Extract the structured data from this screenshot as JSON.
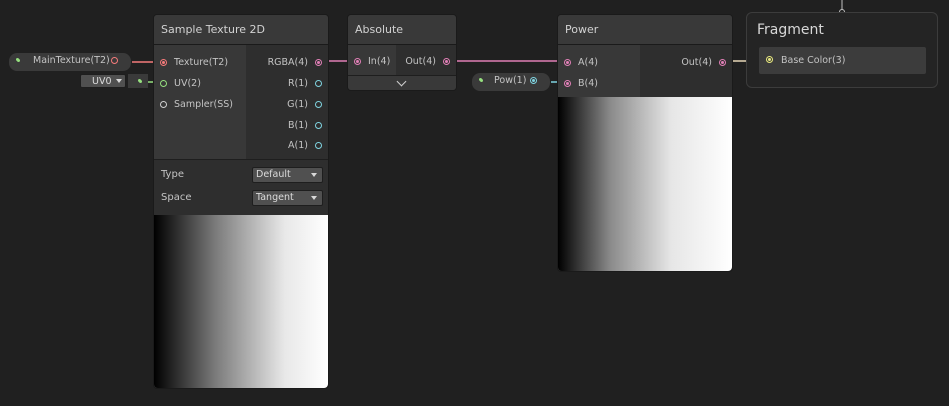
{
  "nodes": {
    "sample_texture": {
      "title": "Sample Texture 2D",
      "inputs": [
        "Texture(T2)",
        "UV(2)",
        "Sampler(SS)"
      ],
      "outputs": [
        "RGBA(4)",
        "R(1)",
        "G(1)",
        "B(1)",
        "A(1)"
      ],
      "type_label": "Type",
      "type_value": "Default",
      "space_label": "Space",
      "space_value": "Tangent"
    },
    "absolute": {
      "title": "Absolute",
      "input": "In(4)",
      "output": "Out(4)"
    },
    "power": {
      "title": "Power",
      "inputs": [
        "A(4)",
        "B(4)"
      ],
      "output": "Out(4)"
    },
    "fragment": {
      "title": "Fragment",
      "input": "Base Color(3)"
    }
  },
  "properties": {
    "main_texture": "MainTexture(T2)",
    "uv_dropdown": "UV0",
    "pow": "Pow(1)"
  },
  "colors": {
    "vector4": "#e07fb6",
    "texture": "#f47a7a",
    "float": "#7fd3e0",
    "vector2": "#96e07f",
    "vector3": "#e8e87f",
    "canvas": "#202020",
    "node_body": "#2e2e2e"
  }
}
